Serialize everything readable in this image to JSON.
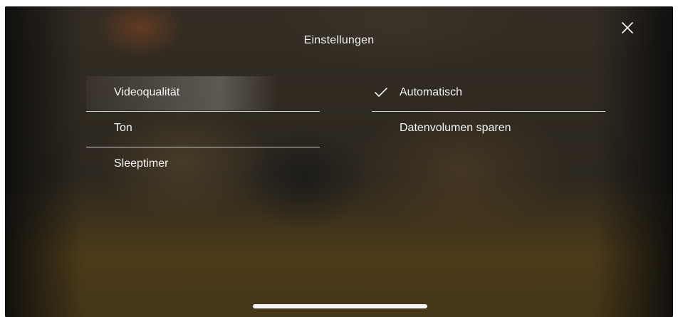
{
  "header": {
    "title": "Einstellungen",
    "close_icon": "close-icon"
  },
  "menu": {
    "items": [
      {
        "label": "Videoqualität",
        "selected": true
      },
      {
        "label": "Ton",
        "selected": false
      },
      {
        "label": "Sleeptimer",
        "selected": false
      }
    ]
  },
  "options": {
    "items": [
      {
        "label": "Automatisch",
        "checked": true,
        "icon": "checkmark-icon"
      },
      {
        "label": "Datenvolumen sparen",
        "checked": false
      }
    ]
  },
  "colors": {
    "text": "#f4f4f4",
    "separator": "#ebebeb",
    "home_indicator": "#f5f5f5"
  }
}
